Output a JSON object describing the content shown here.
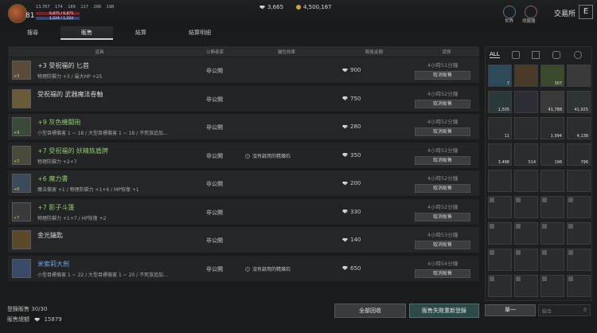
{
  "player": {
    "level": "81",
    "stats": [
      "13,767",
      "174",
      "189",
      "117",
      "266",
      "198"
    ],
    "hp": "6,875 / 6,875",
    "mp": "1,224 / 1,224"
  },
  "currency": {
    "gems": "3,665",
    "gold": "4,500,167"
  },
  "top_icons": [
    {
      "label": "世界",
      "icon": "globe-icon"
    },
    {
      "label": "伺服器",
      "icon": "server-icon"
    }
  ],
  "exchange_title": "交易所",
  "close_label": "E",
  "tabs": [
    "搜尋",
    "販售",
    "結算",
    "結算明細"
  ],
  "table": {
    "headers": [
      "道具",
      "公開者家",
      "屬性效果",
      "販售金額",
      "狀態"
    ],
    "rows": [
      {
        "name": "+3 受祝福的 匕首",
        "color": "normal",
        "enh": "+3",
        "desc": "物理防禦力 +3 / 最大HP +25",
        "public": "非公開",
        "effect": "",
        "price": "900",
        "time": "4小時51分鐘",
        "action": "取消販售"
      },
      {
        "name": "受祝福的 武器魔法卷軸",
        "color": "normal",
        "enh": "",
        "desc": "",
        "public": "非公開",
        "effect": "",
        "price": "750",
        "time": "4小時52分鐘",
        "action": "取消販售"
      },
      {
        "name": "+9 灰色機關砲",
        "color": "green",
        "enh": "+9",
        "desc": "小型目標傷害 1 ~ 18 / 大型目標傷害 1 ~ 18 / 不死族追加...",
        "public": "非公開",
        "effect": "",
        "price": "280",
        "time": "4小時52分鐘",
        "action": "取消販售"
      },
      {
        "name": "+7 受祝福的 妖精族盾牌",
        "color": "green",
        "enh": "+7",
        "desc": "物理防禦力 +2+7",
        "public": "非公開",
        "effect": "沒有啟用的精煉石",
        "price": "350",
        "time": "4小時52分鐘",
        "action": "取消販售"
      },
      {
        "name": "+6 魔力書",
        "color": "green",
        "enh": "+6",
        "desc": "魔法傷害 +1 / 物理防禦力 +1+6 / MP恢復 +1",
        "public": "非公開",
        "effect": "",
        "price": "200",
        "time": "4小時52分鐘",
        "action": "取消販售"
      },
      {
        "name": "+7 影子斗篷",
        "color": "green",
        "enh": "+7",
        "desc": "物理防禦力 +1+7 / HP恢復 +2",
        "public": "非公開",
        "effect": "",
        "price": "330",
        "time": "4小時52分鐘",
        "action": "取消販售"
      },
      {
        "name": "金光鑰匙",
        "color": "normal",
        "enh": "",
        "desc": "",
        "public": "非公開",
        "effect": "",
        "price": "140",
        "time": "4小時53分鐘",
        "action": "取消販售"
      },
      {
        "name": "米索莉大劍",
        "color": "blue",
        "enh": "",
        "desc": "小型目標傷害 1 ~ 22 / 大型目標傷害 1 ~ 20 / 不死族追加...",
        "public": "非公開",
        "effect": "沒有啟用的精煉石",
        "price": "650",
        "time": "4小時54分鐘",
        "action": "取消販售"
      }
    ]
  },
  "footer": {
    "listing_label": "登錄販售",
    "listing_count": "30/30",
    "total_label": "販售總額",
    "total_value": "15879",
    "recall_button": "全部回收",
    "relist_button": "販售失敗重新登錄"
  },
  "inventory": {
    "filters": [
      "ALL",
      "helmet-icon",
      "armor-icon",
      "bag-icon",
      "ring-icon"
    ],
    "counts": [
      "7",
      "",
      "307",
      "",
      "1,505",
      "",
      "41,788",
      "41,925",
      "11",
      "",
      "1,994",
      "4,138",
      "3,498",
      "514",
      "198",
      "796"
    ],
    "single_button": "單一",
    "sum_label": "結合",
    "sum_value": "0"
  }
}
